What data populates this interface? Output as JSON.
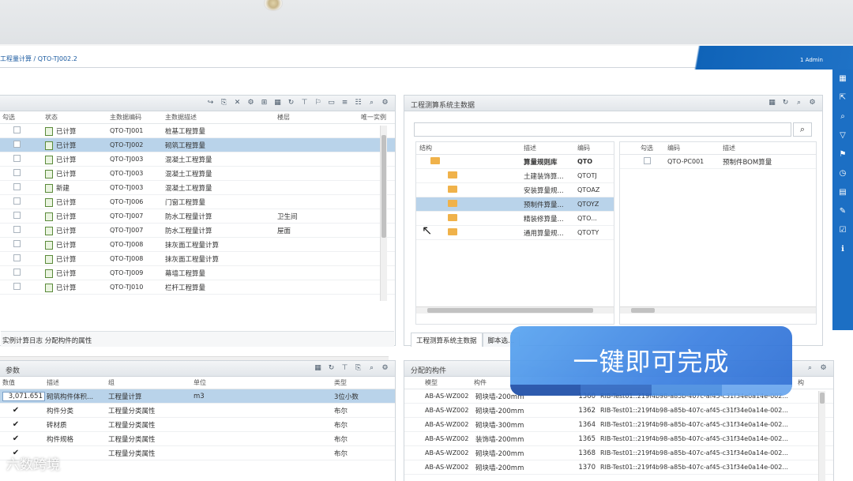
{
  "header": {
    "breadcrumb": "工程量计算 / QTO-TJ002.2",
    "user": "1 Admin"
  },
  "left_top": {
    "columns": [
      "勾选",
      "状态",
      "主数据编码",
      "主数据描述",
      "楼层",
      "唯一实例"
    ],
    "rows": [
      {
        "status": "已计算",
        "code": "QTO-TJ001",
        "desc": "桩基工程算量",
        "floor": ""
      },
      {
        "status": "已计算",
        "code": "QTO-TJ002",
        "desc": "砌筑工程算量",
        "floor": "",
        "selected": true
      },
      {
        "status": "已计算",
        "code": "QTO-TJ003",
        "desc": "混凝土工程算量",
        "floor": ""
      },
      {
        "status": "已计算",
        "code": "QTO-TJ003",
        "desc": "混凝土工程算量",
        "floor": ""
      },
      {
        "status": "新建",
        "code": "QTO-TJ003",
        "desc": "混凝土工程算量",
        "floor": ""
      },
      {
        "status": "已计算",
        "code": "QTO-TJ006",
        "desc": "门窗工程算量",
        "floor": ""
      },
      {
        "status": "已计算",
        "code": "QTO-TJ007",
        "desc": "防水工程量计算",
        "floor": "卫生间"
      },
      {
        "status": "已计算",
        "code": "QTO-TJ007",
        "desc": "防水工程量计算",
        "floor": "屋面"
      },
      {
        "status": "已计算",
        "code": "QTO-TJ008",
        "desc": "抹灰面工程量计算",
        "floor": ""
      },
      {
        "status": "已计算",
        "code": "QTO-TJ008",
        "desc": "抹灰面工程量计算",
        "floor": ""
      },
      {
        "status": "已计算",
        "code": "QTO-TJ009",
        "desc": "幕墙工程算量",
        "floor": ""
      },
      {
        "status": "已计算",
        "code": "QTO-TJ010",
        "desc": "栏杆工程算量",
        "floor": ""
      }
    ],
    "footer": "实例计算日志  分配构件的属性"
  },
  "left_bottom": {
    "title": "参数",
    "columns": [
      "数值",
      "描述",
      "组",
      "单位",
      "类型"
    ],
    "rows": [
      {
        "value": "3,071.651",
        "desc": "砌筑构件体积...",
        "group": "工程量计算",
        "unit": "m3",
        "type": "3位小数",
        "selected": true
      },
      {
        "value": "",
        "desc": "构件分类",
        "group": "工程量分类属性",
        "unit": "",
        "type": "布尔"
      },
      {
        "value": "",
        "desc": "砖材质",
        "group": "工程量分类属性",
        "unit": "",
        "type": "布尔"
      },
      {
        "value": "",
        "desc": "构件规格",
        "group": "工程量分类属性",
        "unit": "",
        "type": "布尔"
      },
      {
        "value": "",
        "desc": "",
        "group": "工程量分类属性",
        "unit": "",
        "type": "布尔"
      }
    ]
  },
  "right_top": {
    "title": "工程测算系统主数据",
    "search_placeholder": "",
    "tree_columns": [
      "结构",
      "描述",
      "编码"
    ],
    "tree": [
      {
        "desc": "算量规则库",
        "code": "QTO",
        "bold": true
      },
      {
        "desc": "土建装饰算...",
        "code": "QTOTJ"
      },
      {
        "desc": "安装算量规...",
        "code": "QTOAZ"
      },
      {
        "desc": "预制件算量...",
        "code": "QTOYZ",
        "selected": true
      },
      {
        "desc": "精装修算量...",
        "code": "QTO..."
      },
      {
        "desc": "通用算量规...",
        "code": "QTOTY"
      }
    ],
    "list_columns": [
      "勾选",
      "编码",
      "描述"
    ],
    "list": [
      {
        "code": "QTO-PC001",
        "desc": "预制件BOM算量"
      }
    ],
    "tabs": [
      "工程测算系统主数据",
      "脚本选..."
    ]
  },
  "right_bottom": {
    "title": "分配的构件",
    "columns": [
      "模型",
      "构件",
      "",
      "",
      "构"
    ],
    "rows": [
      {
        "model": "AB-AS-WZ002",
        "part": "砌块墙-200mm",
        "id": "1360",
        "guid": "RIB-Test01::219f4b98-a85b-407c-af45-c31f34e0a14e-002..."
      },
      {
        "model": "AB-AS-WZ002",
        "part": "砌块墙-200mm",
        "id": "1362",
        "guid": "RIB-Test01::219f4b98-a85b-407c-af45-c31f34e0a14e-002..."
      },
      {
        "model": "AB-AS-WZ002",
        "part": "砌块墙-300mm",
        "id": "1364",
        "guid": "RIB-Test01::219f4b98-a85b-407c-af45-c31f34e0a14e-002..."
      },
      {
        "model": "AB-AS-WZ002",
        "part": "装饰墙-200mm",
        "id": "1365",
        "guid": "RIB-Test01::219f4b98-a85b-407c-af45-c31f34e0a14e-002..."
      },
      {
        "model": "AB-AS-WZ002",
        "part": "砌块墙-200mm",
        "id": "1368",
        "guid": "RIB-Test01::219f4b98-a85b-407c-af45-c31f34e0a14e-002..."
      },
      {
        "model": "AB-AS-WZ002",
        "part": "砌块墙-200mm",
        "id": "1370",
        "guid": "RIB-Test01::219f4b98-a85b-407c-af45-c31f34e0a14e-002..."
      }
    ]
  },
  "overlay": {
    "text": "一键即可完成"
  },
  "watermark": "六数跨境",
  "colors": {
    "accent": "#1c6fc4",
    "selection": "#b9d3ea",
    "folder": "#f0b24a"
  }
}
